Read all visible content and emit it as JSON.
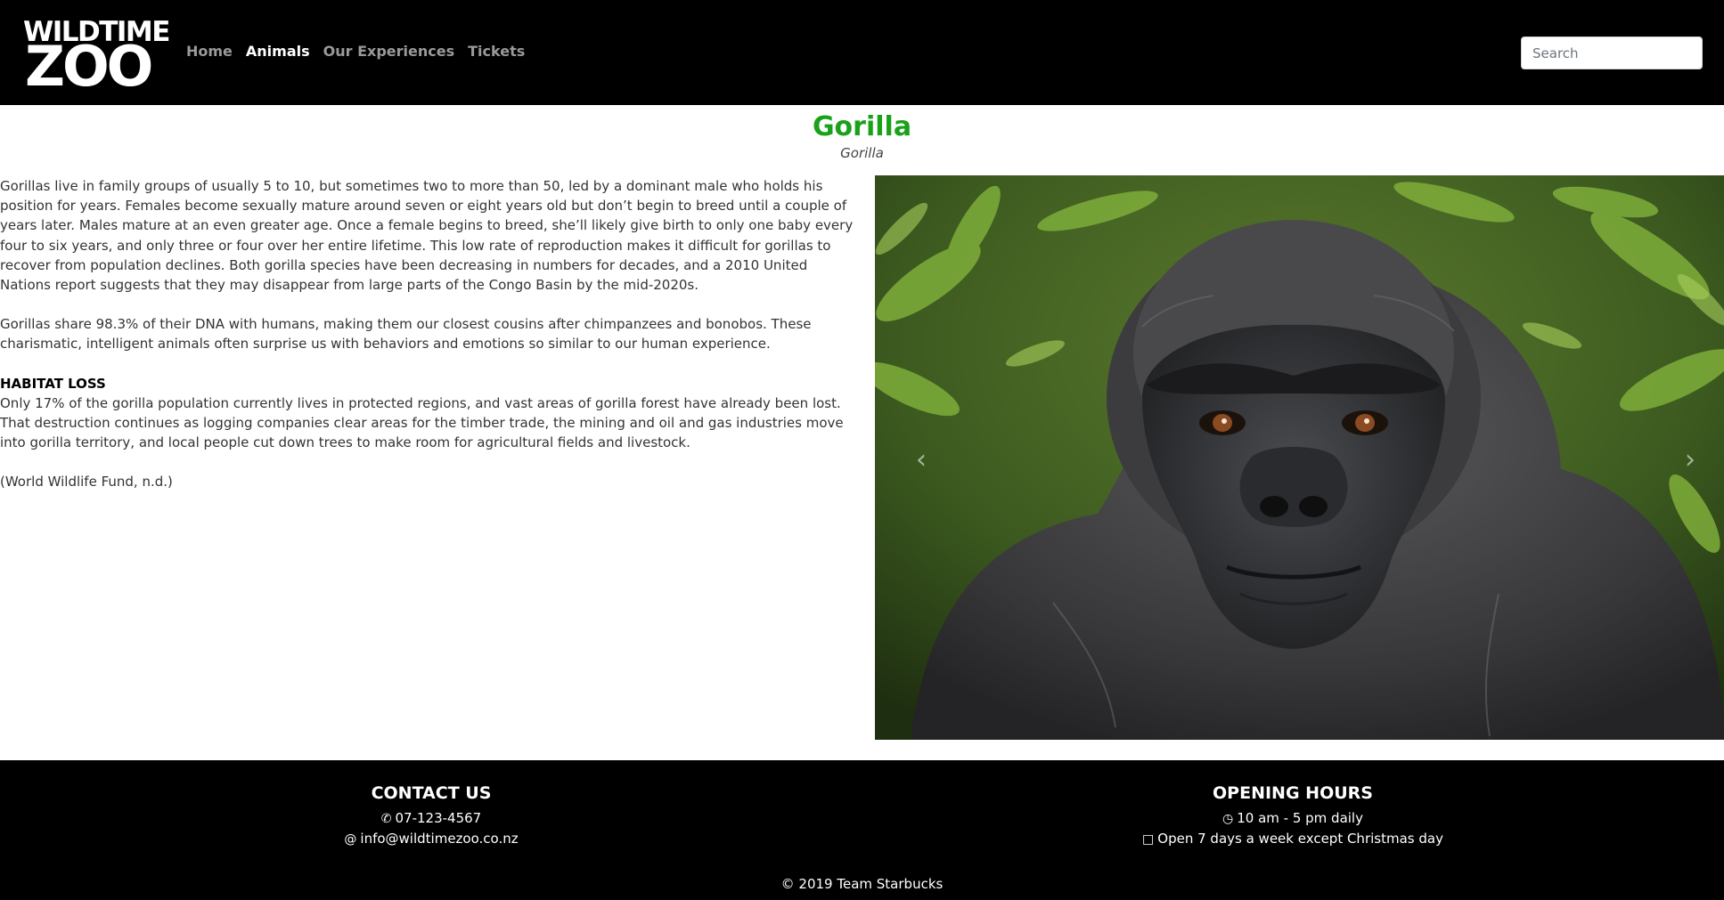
{
  "brand": {
    "logo_top": "WILDTIME",
    "logo_bottom": "ZOO"
  },
  "nav": {
    "items": [
      {
        "label": "Home",
        "active": false
      },
      {
        "label": "Animals",
        "active": true
      },
      {
        "label": "Our Experiences",
        "active": false
      },
      {
        "label": "Tickets",
        "active": false
      }
    ],
    "search_placeholder": "Search"
  },
  "animal": {
    "title": "Gorilla",
    "subtitle": "Gorilla",
    "paragraph1": "Gorillas live in family groups of usually 5 to 10, but sometimes two to more than 50, led by a dominant male who holds his position for years. Females become sexually mature around seven or eight years old but don’t begin to breed until a couple of years later. Males mature at an even greater age. Once a female begins to breed, she’ll likely give birth to only one baby every four to six years, and only three or four over her entire lifetime. This low rate of reproduction makes it difficult for gorillas to recover from population declines. Both gorilla species have been decreasing in numbers for decades, and a 2010 United Nations report suggests that they may disappear from large parts of the Congo Basin by the mid-2020s.",
    "paragraph2": "Gorillas share 98.3% of their DNA with humans, making them our closest cousins after chimpanzees and bonobos. These charismatic, intelligent animals often surprise us with behaviors and emotions so similar to our human experience.",
    "section_heading": "HABITAT LOSS",
    "paragraph3": "Only 17% of the gorilla population currently lives in protected regions, and vast areas of gorilla forest have already been lost. That destruction continues as logging companies clear areas for the timber trade, the mining and oil and gas industries move into gorilla territory, and local people cut down trees to make room for agricultural fields and livestock.",
    "citation": "(World Wildlife Fund, n.d.)"
  },
  "carousel": {
    "prev_icon": "chevron-left-icon",
    "next_icon": "chevron-right-icon"
  },
  "footer": {
    "contact_heading": "CONTACT US",
    "phone": "07-123-4567",
    "email": "info@wildtimezoo.co.nz",
    "hours_heading": "OPENING HOURS",
    "hours": "10 am - 5 pm daily",
    "days": "Open 7 days a week except Christmas day",
    "copyright": "© 2019 Team Starbucks"
  },
  "colors": {
    "title_green": "#1aa11a",
    "navbar_bg": "#000000",
    "nav_inactive": "#9a9a9a",
    "nav_active": "#ffffff"
  }
}
